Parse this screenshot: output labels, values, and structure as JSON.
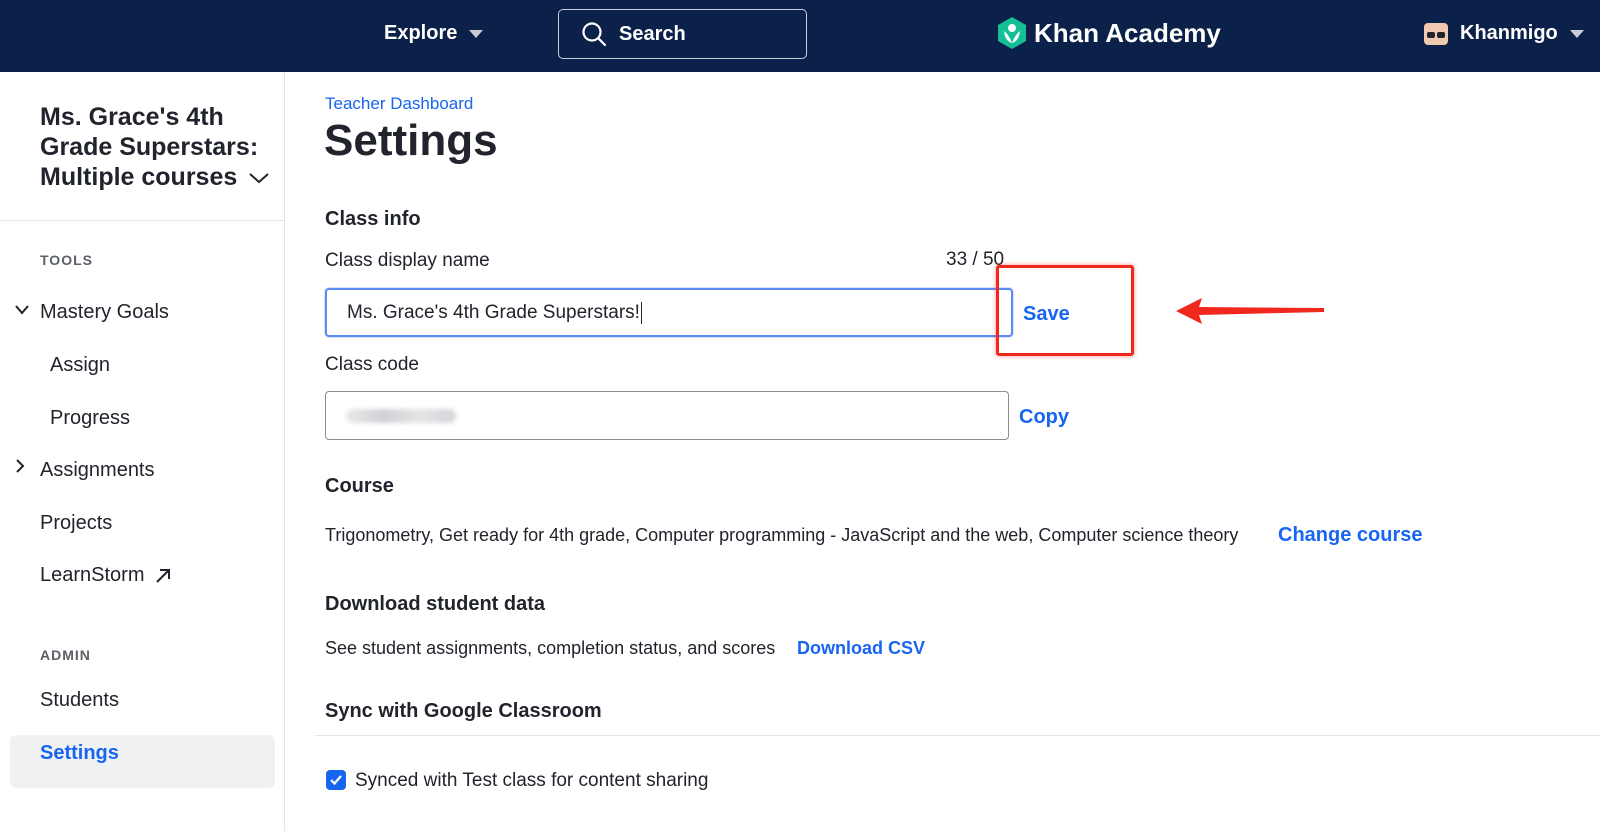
{
  "topbar": {
    "explore_label": "Explore",
    "search_label": "Search",
    "logo_text": "Khan Academy",
    "user_label": "Khanmigo",
    "bar_color": "#0b2149"
  },
  "sidebar": {
    "class_title": "Ms. Grace's 4th Grade Superstars: Multiple courses",
    "tools_heading": "TOOLS",
    "items": {
      "mastery_goals": "Mastery Goals",
      "assign": "Assign",
      "progress": "Progress",
      "assignments": "Assignments",
      "projects": "Projects",
      "learnstorm": "LearnStorm"
    },
    "admin_heading": "ADMIN",
    "admin_items": {
      "students": "Students",
      "settings": "Settings"
    }
  },
  "main": {
    "breadcrumb": "Teacher Dashboard",
    "title": "Settings",
    "class_info": {
      "heading": "Class info",
      "display_name_label": "Class display name",
      "char_count": "33 / 50",
      "display_name_value": "Ms. Grace's 4th Grade Superstars!",
      "save_label": "Save",
      "class_code_label": "Class code",
      "copy_label": "Copy"
    },
    "course": {
      "heading": "Course",
      "courses_text": "Trigonometry, Get ready for 4th grade, Computer programming - JavaScript and the web, Computer science theory",
      "change_label": "Change course"
    },
    "download": {
      "heading": "Download student data",
      "description": "See student assignments, completion status, and scores",
      "link_label": "Download CSV"
    },
    "sync": {
      "heading": "Sync with Google Classroom",
      "checkbox_label": "Synced with Test class for content sharing",
      "checked": true
    }
  },
  "colors": {
    "link": "#1865f2",
    "annotation": "#f0281e",
    "logo_green": "#14bf96"
  }
}
